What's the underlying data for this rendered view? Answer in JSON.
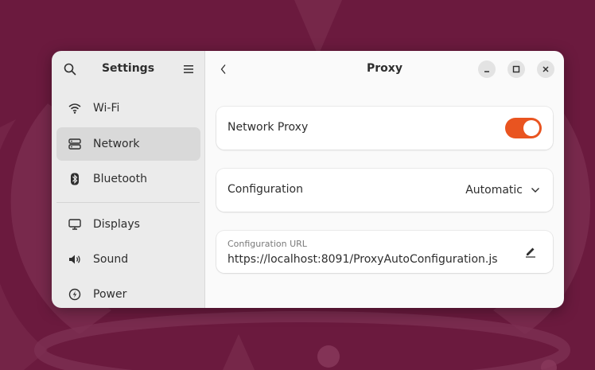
{
  "sidebar": {
    "title": "Settings",
    "items": [
      {
        "label": "Wi-Fi",
        "icon": "wifi-icon"
      },
      {
        "label": "Network",
        "icon": "network-icon",
        "active": true
      },
      {
        "label": "Bluetooth",
        "icon": "bluetooth-icon"
      },
      {
        "label": "Displays",
        "icon": "display-icon"
      },
      {
        "label": "Sound",
        "icon": "speaker-icon"
      },
      {
        "label": "Power",
        "icon": "power-icon"
      }
    ]
  },
  "page": {
    "title": "Proxy",
    "network_proxy": {
      "label": "Network Proxy",
      "enabled": true
    },
    "configuration": {
      "label": "Configuration",
      "value": "Automatic"
    },
    "config_url": {
      "label": "Configuration URL",
      "value": "https://localhost:8091/ProxyAutoConfiguration.js"
    }
  },
  "colors": {
    "accent": "#e95420",
    "wallpaper": "#6b1a3e",
    "sidebar_bg": "#ebebeb",
    "content_bg": "#fafafa"
  }
}
